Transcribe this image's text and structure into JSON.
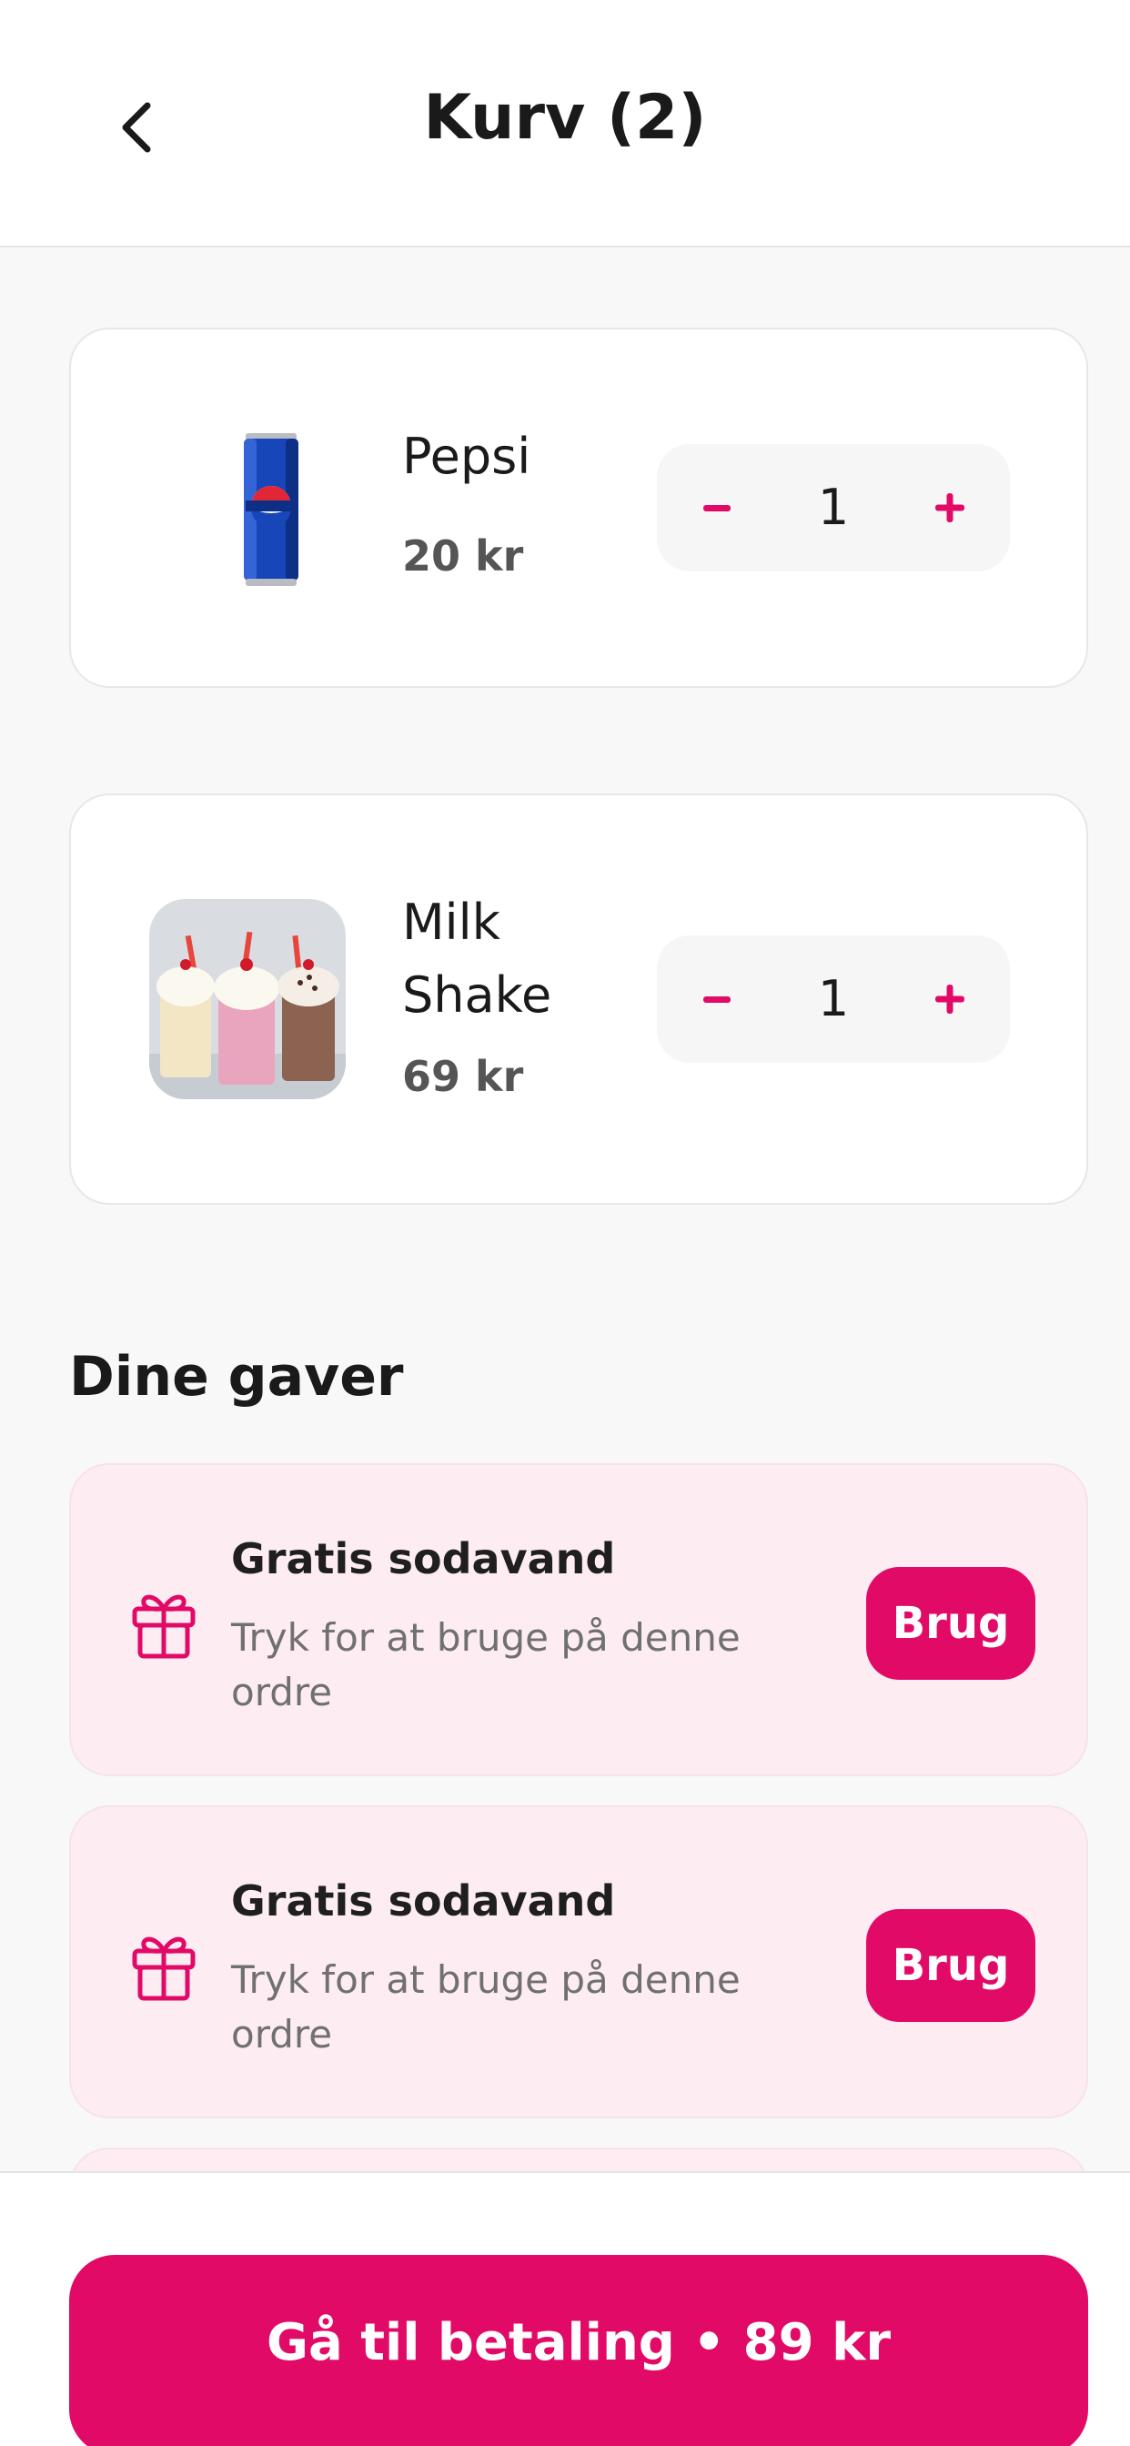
{
  "header": {
    "title": "Kurv (2)",
    "back_icon": "chevron-left-icon"
  },
  "cart": {
    "items": [
      {
        "name": "Pepsi",
        "price": "20 kr",
        "quantity": "1",
        "image": "pepsi-can-image",
        "minus": "−",
        "plus": "+"
      },
      {
        "name": "Milk Shake",
        "price": "69 kr",
        "quantity": "1",
        "image": "milkshakes-image",
        "minus": "−",
        "plus": "+"
      }
    ]
  },
  "gifts": {
    "title": "Dine gaver",
    "items": [
      {
        "title": "Gratis sodavand",
        "description": "Tryk for at bruge på denne ordre",
        "button": "Brug",
        "icon": "gift-icon"
      },
      {
        "title": "Gratis sodavand",
        "description": "Tryk for at bruge på denne ordre",
        "button": "Brug",
        "icon": "gift-icon"
      }
    ]
  },
  "footer": {
    "checkout_label": "Gå til betaling • 89 kr"
  },
  "colors": {
    "accent": "#e20a67",
    "gift_bg": "#fdedf3",
    "background": "#f8f8f8"
  }
}
